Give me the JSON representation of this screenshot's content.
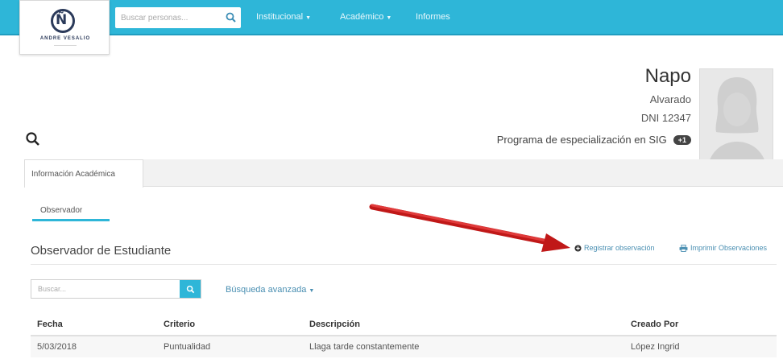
{
  "navbar": {
    "logo_text": "ANDRE VESALIO",
    "search_placeholder": "Buscar personas...",
    "menu": [
      {
        "label": "Institucional",
        "has_caret": true
      },
      {
        "label": "Académico",
        "has_caret": true
      },
      {
        "label": "Informes",
        "has_caret": false
      }
    ]
  },
  "profile": {
    "first_name": "Napo",
    "last_name": "Alvarado",
    "dni": "DNI 12347",
    "program": "Programa de especialización en SIG",
    "badge": "+1"
  },
  "tabs": [
    {
      "label": "Información Académica",
      "active": true
    }
  ],
  "subtabs": [
    {
      "label": "Observador",
      "active": true
    }
  ],
  "section": {
    "title": "Observador de Estudiante",
    "actions": [
      {
        "label": "Registrar observación",
        "icon": "plus-circle-icon"
      },
      {
        "label": "Imprimir Observaciones",
        "icon": "print-icon"
      }
    ]
  },
  "filter": {
    "placeholder": "Buscar...",
    "advanced_label": "Búsqueda avanzada"
  },
  "table": {
    "columns": [
      "Fecha",
      "Criterio",
      "Descripción",
      "Creado Por"
    ],
    "rows": [
      [
        "5/03/2018",
        "Puntualidad",
        "Llaga tarde constantemente",
        "López Ingrid"
      ]
    ]
  },
  "colors": {
    "navbar": "#2eb6d8",
    "link": "#4a8fb2",
    "arrow": "#d42626"
  }
}
